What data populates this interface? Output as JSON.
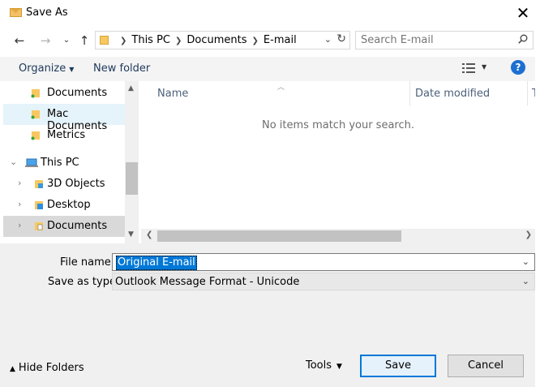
{
  "window": {
    "title": "Save As"
  },
  "nav": {
    "breadcrumb": [
      "This PC",
      "Documents",
      "E-mail"
    ],
    "search_placeholder": "Search E-mail"
  },
  "toolbar": {
    "organize": "Organize",
    "new_folder": "New folder",
    "help": "?"
  },
  "sidebar": {
    "items": [
      {
        "label": "Documents"
      },
      {
        "label": "Mac Documents"
      },
      {
        "label": "Metrics"
      },
      {
        "label": "This PC"
      },
      {
        "label": "3D Objects"
      },
      {
        "label": "Desktop"
      },
      {
        "label": "Documents"
      }
    ]
  },
  "file_list": {
    "columns": [
      "Name",
      "Date modified",
      "T"
    ],
    "empty_message": "No items match your search."
  },
  "form": {
    "file_name_label": "File name:",
    "file_name_value": "Original E-mail",
    "save_as_type_label": "Save as type:",
    "save_as_type_value": "Outlook Message Format - Unicode"
  },
  "footer": {
    "hide_folders": "Hide Folders",
    "tools": "Tools",
    "save": "Save",
    "cancel": "Cancel"
  },
  "colors": {
    "accent": "#0078d7",
    "help": "#1d6fd1",
    "selection": "#e5f3fb"
  }
}
